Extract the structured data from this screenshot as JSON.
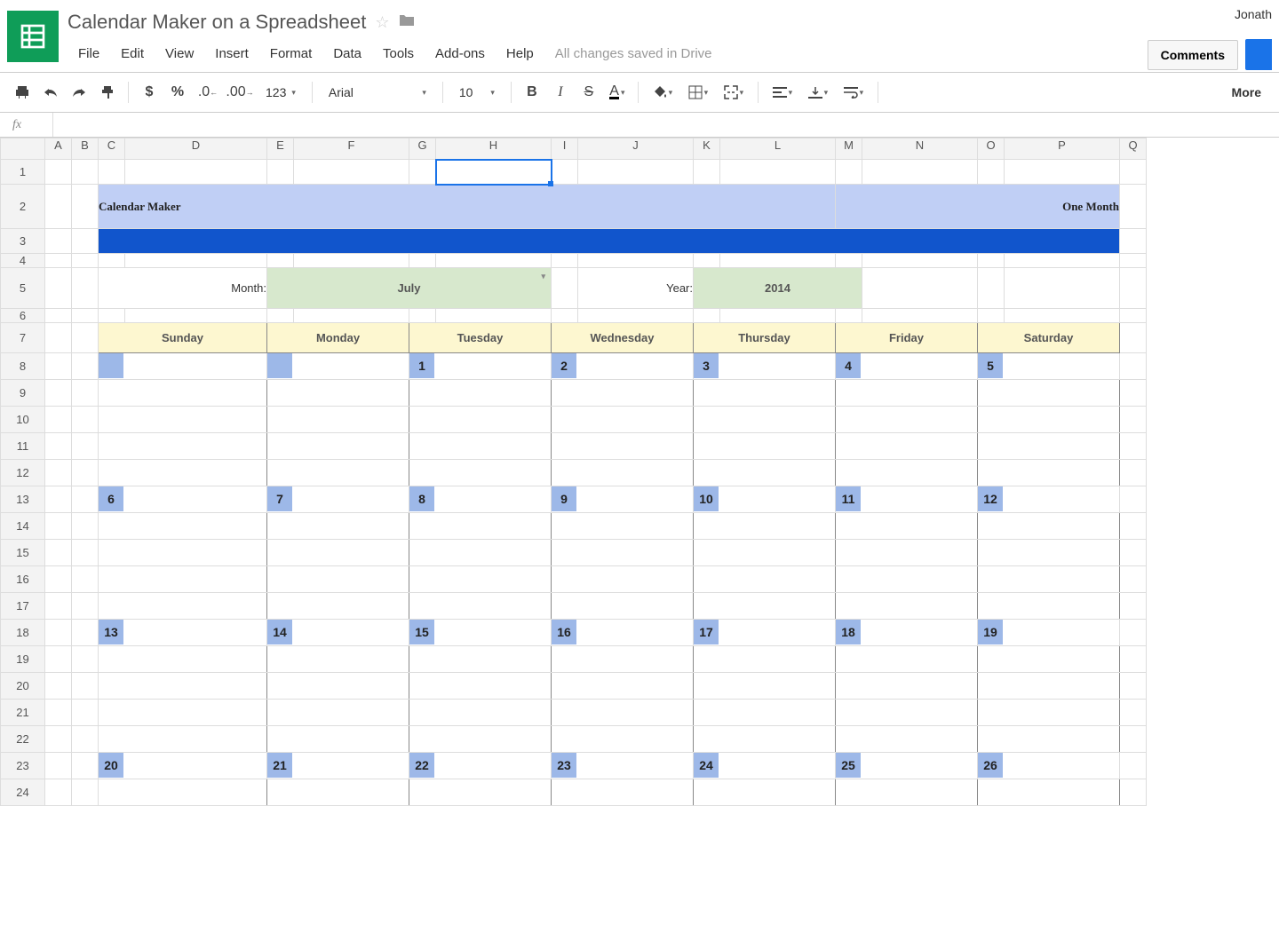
{
  "header": {
    "doc_title": "Calendar Maker on a Spreadsheet",
    "user_name": "Jonath",
    "comments_label": "Comments",
    "save_status": "All changes saved in Drive"
  },
  "menu": {
    "file": "File",
    "edit": "Edit",
    "view": "View",
    "insert": "Insert",
    "format": "Format",
    "data": "Data",
    "tools": "Tools",
    "addons": "Add-ons",
    "help": "Help"
  },
  "toolbar": {
    "font": "Arial",
    "font_size": "10",
    "num_fmt": "123",
    "more": "More"
  },
  "fx": {
    "label": "fx"
  },
  "columns": [
    "A",
    "B",
    "C",
    "D",
    "E",
    "F",
    "G",
    "H",
    "I",
    "J",
    "K",
    "L",
    "M",
    "N",
    "O",
    "P",
    "Q"
  ],
  "rows": [
    "1",
    "2",
    "3",
    "4",
    "5",
    "6",
    "7",
    "8",
    "9",
    "10",
    "11",
    "12",
    "13",
    "14",
    "15",
    "16",
    "17",
    "18",
    "19",
    "20",
    "21",
    "22",
    "23",
    "24"
  ],
  "sheet": {
    "title_left": "Calendar Maker",
    "title_right": "One Month",
    "month_label": "Month:",
    "month_value": "July",
    "year_label": "Year:",
    "year_value": "2014",
    "days": [
      "Sunday",
      "Monday",
      "Tuesday",
      "Wednesday",
      "Thursday",
      "Friday",
      "Saturday"
    ],
    "weeks": [
      [
        "",
        "",
        "1",
        "2",
        "3",
        "4",
        "5"
      ],
      [
        "6",
        "7",
        "8",
        "9",
        "10",
        "11",
        "12"
      ],
      [
        "13",
        "14",
        "15",
        "16",
        "17",
        "18",
        "19"
      ],
      [
        "20",
        "21",
        "22",
        "23",
        "24",
        "25",
        "26"
      ]
    ]
  },
  "col_widths": {
    "A": 30,
    "B": 30,
    "C": 30,
    "D": 160,
    "E": 30,
    "F": 130,
    "G": 30,
    "H": 130,
    "I": 30,
    "J": 130,
    "K": 30,
    "L": 130,
    "M": 30,
    "N": 130,
    "O": 30,
    "P": 130,
    "Q": 30
  }
}
